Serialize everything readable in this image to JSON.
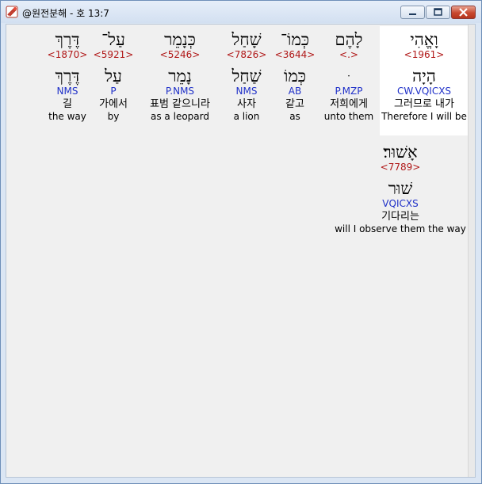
{
  "window": {
    "title": "@원전분해 - 호 13:7"
  },
  "words": [
    {
      "hebrew": "וָאֱהִי",
      "strong": "<1961>",
      "lemma": "הָיָה",
      "morph": "CW.VQICXS",
      "korean": "그러므로 내가",
      "english": "Therefore I will be"
    },
    {
      "hebrew": "לָהֶם",
      "strong": "<.>",
      "lemma": "ּ",
      "morph": "P.MZP",
      "korean": "저희에게",
      "english": "unto them"
    },
    {
      "hebrew": "כְּמוֹ־",
      "strong": "<3644>",
      "lemma": "כְּמוֹ",
      "morph": "AB",
      "korean": "같고",
      "english": "as"
    },
    {
      "hebrew": "שָׁחַל",
      "strong": "<7826>",
      "lemma": "שַׁחַל",
      "morph": "NMS",
      "korean": "사자",
      "english": "a lion"
    },
    {
      "hebrew": "כְּנָמֵר",
      "strong": "<5246>",
      "lemma": "נָמֵר",
      "morph": "P.NMS",
      "korean": "표범 같으니라",
      "english": "as a leopard"
    },
    {
      "hebrew": "עַל־",
      "strong": "<5921>",
      "lemma": "עַל",
      "morph": "P",
      "korean": "가에서",
      "english": "by"
    },
    {
      "hebrew": "דֶּרֶךְ",
      "strong": "<1870>",
      "lemma": "דֶּרֶךְ",
      "morph": "NMS",
      "korean": "길",
      "english": "the way"
    },
    {
      "hebrew": "אָשׁוּר׃",
      "strong": "<7789>",
      "lemma": "שׁוּר",
      "morph": "VQICXS",
      "korean": "기다리는",
      "english": "will I observe them the way"
    }
  ]
}
